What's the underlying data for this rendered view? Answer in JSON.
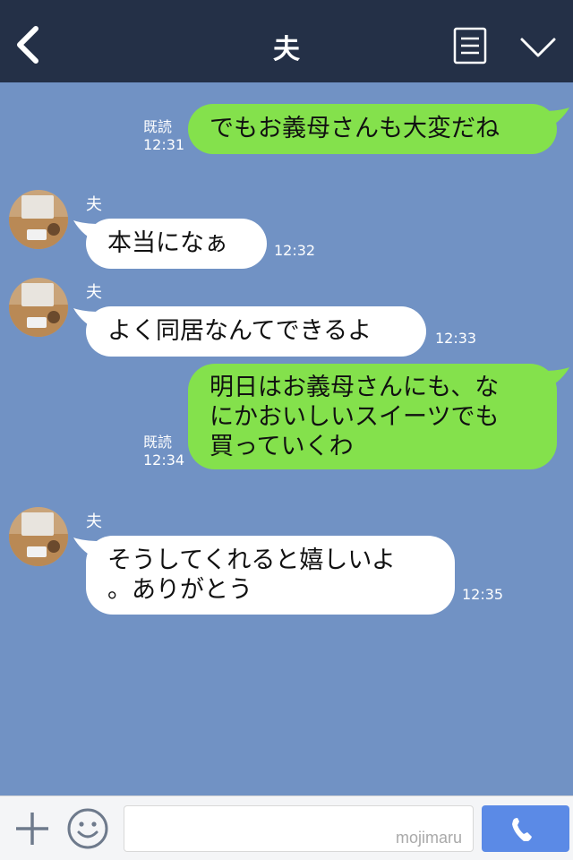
{
  "header": {
    "title": "夫",
    "back_icon": "chevron-left-icon",
    "menu_icon": "list-icon",
    "collapse_icon": "chevron-down-icon"
  },
  "messages": [
    {
      "from": "me",
      "text": "でもお義母さんも大変だね",
      "read": "既読",
      "time": "12:31"
    },
    {
      "from": "them",
      "sender": "夫",
      "text": "本当になぁ",
      "time": "12:32"
    },
    {
      "from": "them",
      "sender": "夫",
      "text": "よく同居なんてできるよ",
      "time": "12:33"
    },
    {
      "from": "me",
      "lines": [
        "明日はお義母さんにも、な",
        "にかおいしいスイーツでも",
        "買っていくわ"
      ],
      "read": "既読",
      "time": "12:34"
    },
    {
      "from": "them",
      "sender": "夫",
      "lines": [
        "そうしてくれると嬉しいよ",
        "。ありがとう"
      ],
      "time": "12:35"
    }
  ],
  "footer": {
    "input_placeholder": "",
    "watermark": "mojimaru",
    "plus_icon": "plus-icon",
    "emoji_icon": "smiley-icon",
    "call_icon": "phone-icon"
  },
  "colors": {
    "background": "#7192c4",
    "header": "#243047",
    "my_bubble": "#84e14c",
    "their_bubble": "#ffffff",
    "call_button": "#5b8ae6"
  }
}
